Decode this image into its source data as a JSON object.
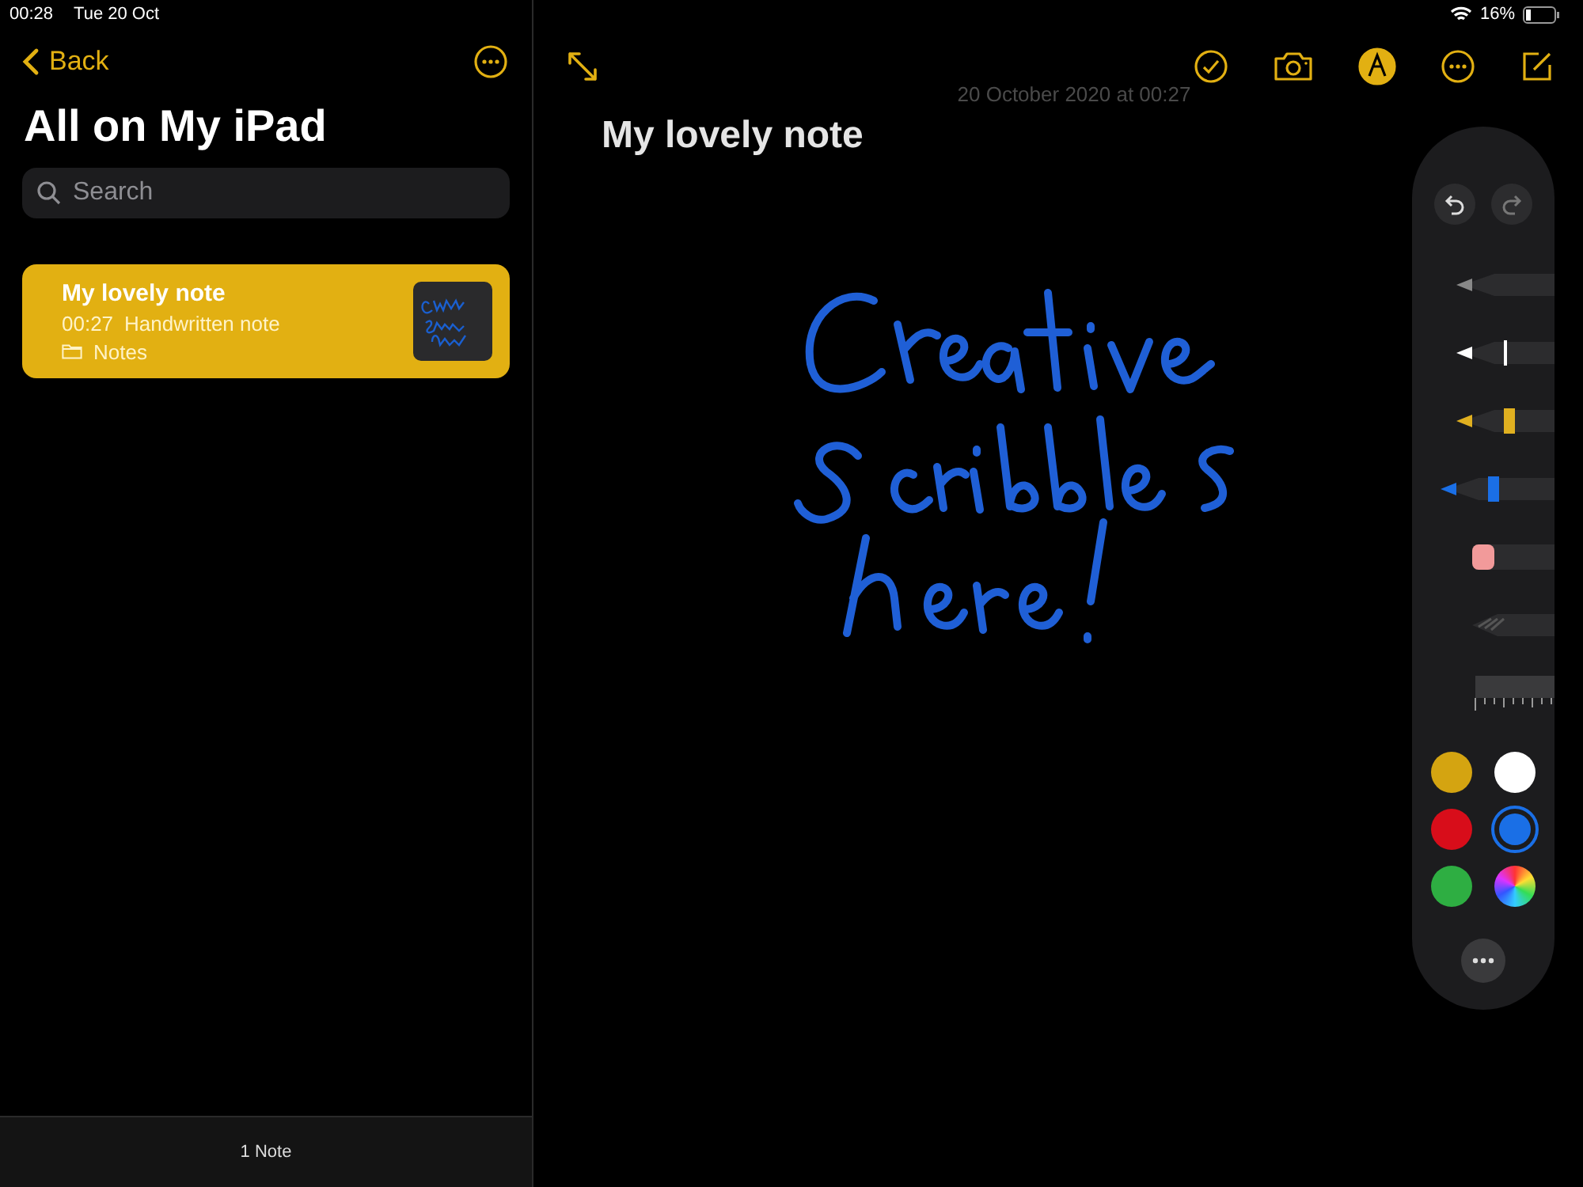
{
  "status_bar": {
    "time": "00:28",
    "date": "Tue 20 Oct",
    "battery": "16%"
  },
  "sidebar": {
    "back": "Back",
    "title": "All on My iPad",
    "search": {
      "placeholder": "Search"
    },
    "notes": [
      {
        "title": "My lovely note",
        "time": "00:27",
        "subtitle": "Handwritten note",
        "folder": "Notes",
        "selected": true
      }
    ],
    "footer": "1 Note"
  },
  "note": {
    "date": "20 October 2020 at 00:27",
    "title": "My lovely note"
  },
  "toolbar": {
    "markup_active": true
  },
  "palette": {
    "tools": [
      {
        "kind": "pen",
        "selected": false
      },
      {
        "kind": "marker",
        "selected": false
      },
      {
        "kind": "highlighter",
        "selected": false
      },
      {
        "kind": "pencil",
        "selected": true
      },
      {
        "kind": "eraser",
        "selected": false
      },
      {
        "kind": "lasso",
        "selected": false
      },
      {
        "kind": "ruler",
        "selected": false
      }
    ],
    "colors": [
      {
        "color": "#d4a411",
        "selected": false
      },
      {
        "color": "#ffffff",
        "selected": false
      },
      {
        "color": "#d80d1a",
        "selected": false
      },
      {
        "color": "#1a6fe6",
        "selected": true
      },
      {
        "color": "#2eae42",
        "selected": false
      },
      {
        "kind": "spectrum",
        "selected": false
      }
    ]
  }
}
